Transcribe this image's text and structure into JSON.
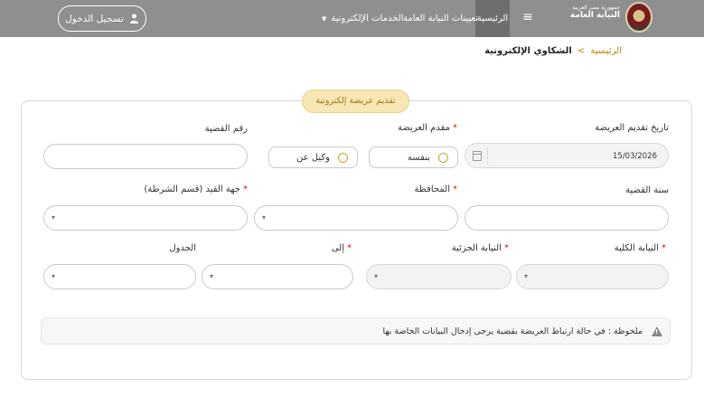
{
  "header": {
    "logo_small": "جمهورية مصر العربية",
    "logo_big": "النيابة العامة",
    "nav": {
      "home": "الرئيسية",
      "appointments": "تعيينات النيابة العامة",
      "eservices": "الخدمات الإلكترونية"
    },
    "login": "تسجيل الدخول"
  },
  "breadcrumb": {
    "home": "الرئيسية",
    "separator": ">",
    "current": "الشكاوي الإلكترونية"
  },
  "form": {
    "title": "تقديم عريضة إلكترونية",
    "submission_date_label": "تاريخ تقديم العريضة",
    "submission_date_value": "15/03/2026",
    "submitter_label": "مقدم العريضة",
    "submitter_options": [
      "بنفسه",
      "وكيل عن"
    ],
    "case_number_label": "رقم القضية",
    "case_year_label": "سنة القضية",
    "governorate_label": "المحافظة",
    "registry_label": "جهة القيد (قسم الشرطة)",
    "total_prosecution_label": "النيابة الكلية",
    "partial_prosecution_label": "النيابة الجزئية",
    "to_label": "إلى",
    "schedule_label": "الجدول",
    "note": "ملحوظة : في حالة ارتباط العريضة بقضية يرجى إدخال البيانات الخاصة بها"
  },
  "colors": {
    "header_bg": "#8f8f8f",
    "accent_gold": "#b8860b",
    "required_red": "#dd1111"
  }
}
